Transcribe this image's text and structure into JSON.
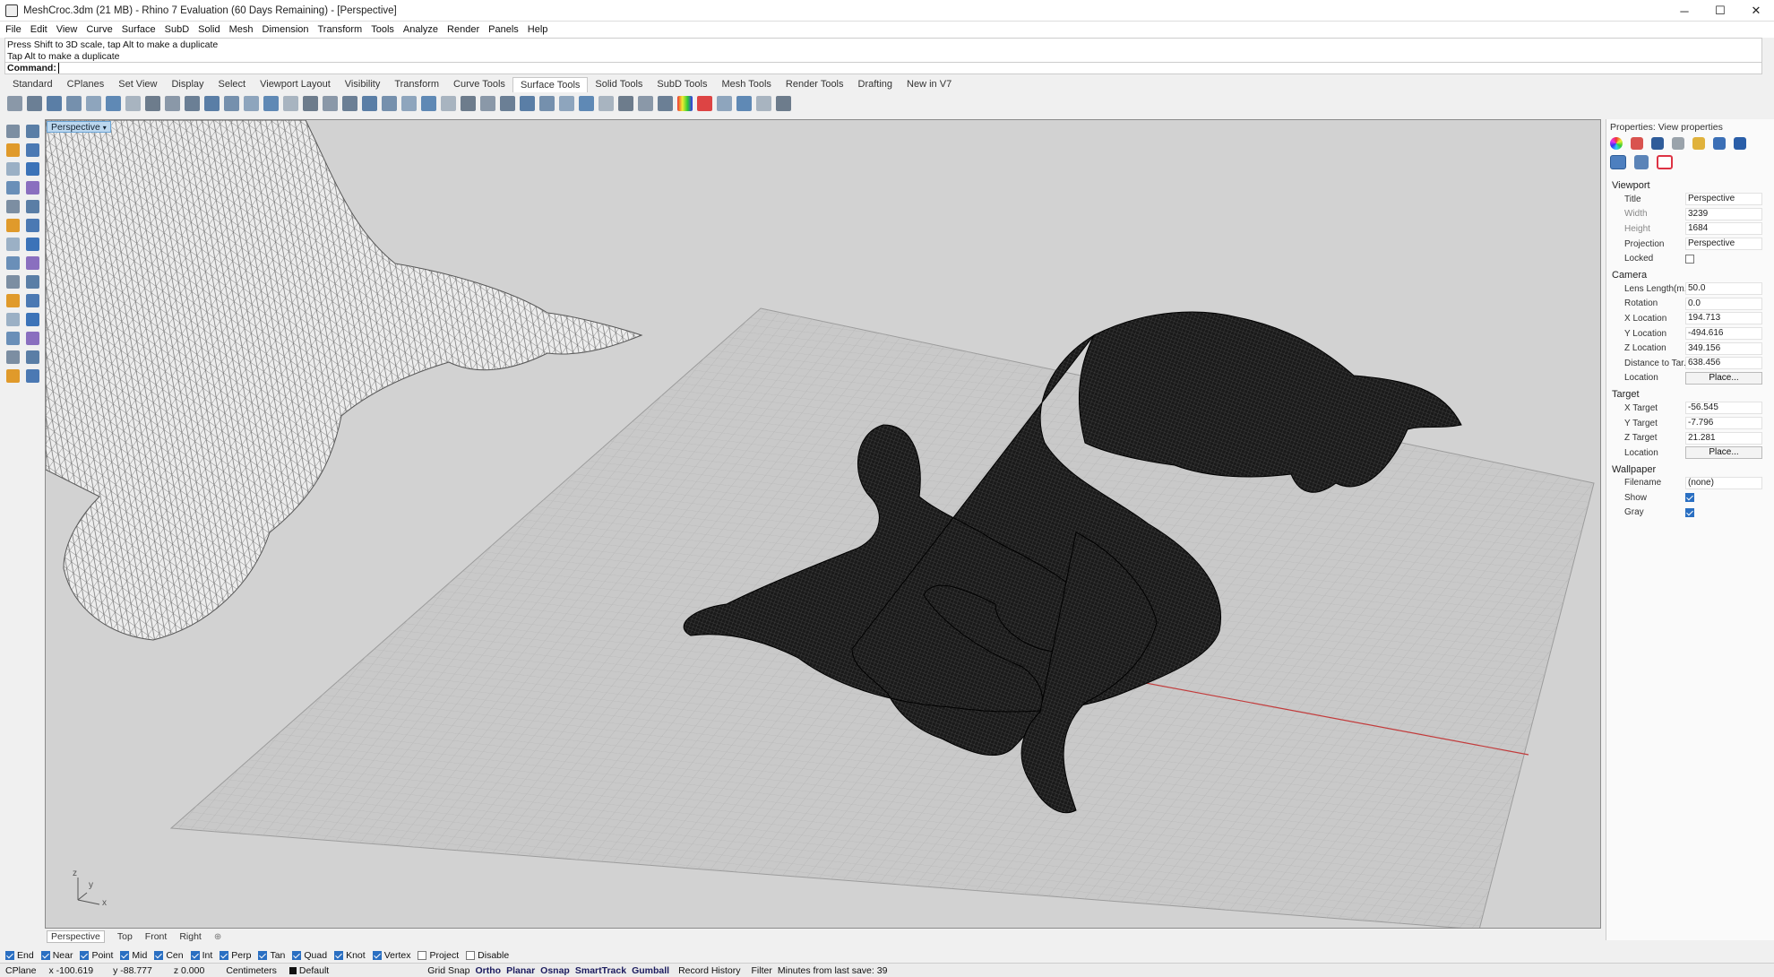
{
  "window": {
    "title": "MeshCroc.3dm (21 MB) - Rhino 7 Evaluation (60 Days Remaining) - [Perspective]",
    "minimize": "─",
    "maximize": "☐",
    "close": "✕"
  },
  "menu": [
    "File",
    "Edit",
    "View",
    "Curve",
    "Surface",
    "SubD",
    "Solid",
    "Mesh",
    "Dimension",
    "Transform",
    "Tools",
    "Analyze",
    "Render",
    "Panels",
    "Help"
  ],
  "command": {
    "history": [
      "Press Shift to 3D scale, tap Alt to make a duplicate",
      "Tap Alt to make a duplicate"
    ],
    "prompt": "Command:"
  },
  "toolbar_tabs": [
    "Standard",
    "CPlanes",
    "Set View",
    "Display",
    "Select",
    "Viewport Layout",
    "Visibility",
    "Transform",
    "Curve Tools",
    "Surface Tools",
    "Solid Tools",
    "SubD Tools",
    "Mesh Tools",
    "Render Tools",
    "Drafting",
    "New in V7"
  ],
  "active_toolbar_tab": "Surface Tools",
  "viewport": {
    "label": "Perspective",
    "axis_x": "x",
    "axis_y": "y",
    "axis_z": "z"
  },
  "viewport_tabs": [
    "Perspective",
    "Top",
    "Front",
    "Right"
  ],
  "osnaps": [
    {
      "label": "End",
      "on": true
    },
    {
      "label": "Near",
      "on": true
    },
    {
      "label": "Point",
      "on": true
    },
    {
      "label": "Mid",
      "on": true
    },
    {
      "label": "Cen",
      "on": true
    },
    {
      "label": "Int",
      "on": true
    },
    {
      "label": "Perp",
      "on": true
    },
    {
      "label": "Tan",
      "on": true
    },
    {
      "label": "Quad",
      "on": true
    },
    {
      "label": "Knot",
      "on": true
    },
    {
      "label": "Vertex",
      "on": true
    },
    {
      "label": "Project",
      "on": false
    },
    {
      "label": "Disable",
      "on": false
    }
  ],
  "status": {
    "cplane": "CPlane",
    "x": "x -100.619",
    "y": "y -88.777",
    "z": "z 0.000",
    "units": "Centimeters",
    "layer": "Default",
    "grid_snap": "Grid Snap",
    "ortho": "Ortho",
    "planar": "Planar",
    "osnap": "Osnap",
    "smarttrack": "SmartTrack",
    "gumball": "Gumball",
    "record_history": "Record History",
    "filter": "Filter",
    "save_info": "Minutes from last save: 39"
  },
  "properties": {
    "title": "Properties: View properties",
    "viewport_header": "Viewport",
    "viewport": [
      {
        "key": "Title",
        "value": "Perspective"
      },
      {
        "key": "Width",
        "value": "3239",
        "dim": true
      },
      {
        "key": "Height",
        "value": "1684",
        "dim": true
      },
      {
        "key": "Projection",
        "value": "Perspective"
      },
      {
        "key": "Locked",
        "value": ""
      }
    ],
    "camera_header": "Camera",
    "camera": [
      {
        "key": "Lens Length(m...",
        "value": "50.0"
      },
      {
        "key": "Rotation",
        "value": "0.0"
      },
      {
        "key": "X Location",
        "value": "194.713"
      },
      {
        "key": "Y Location",
        "value": "-494.616"
      },
      {
        "key": "Z Location",
        "value": "349.156"
      },
      {
        "key": "Distance to Tar...",
        "value": "638.456"
      },
      {
        "key": "Location",
        "value": "Place..."
      }
    ],
    "target_header": "Target",
    "target": [
      {
        "key": "X Target",
        "value": "-56.545"
      },
      {
        "key": "Y Target",
        "value": "-7.796"
      },
      {
        "key": "Z Target",
        "value": "21.281"
      },
      {
        "key": "Location",
        "value": "Place..."
      }
    ],
    "wallpaper_header": "Wallpaper",
    "wallpaper": [
      {
        "key": "Filename",
        "value": "(none)"
      },
      {
        "key": "Show",
        "value": ""
      },
      {
        "key": "Gray",
        "value": ""
      }
    ]
  },
  "colors": {
    "accent": "#2a6fc2",
    "viewport_bg": "#d2d2d2",
    "grid": "#b4b4b4",
    "x_axis": "#c23b3b",
    "y_axis": "#3a9a3a"
  }
}
